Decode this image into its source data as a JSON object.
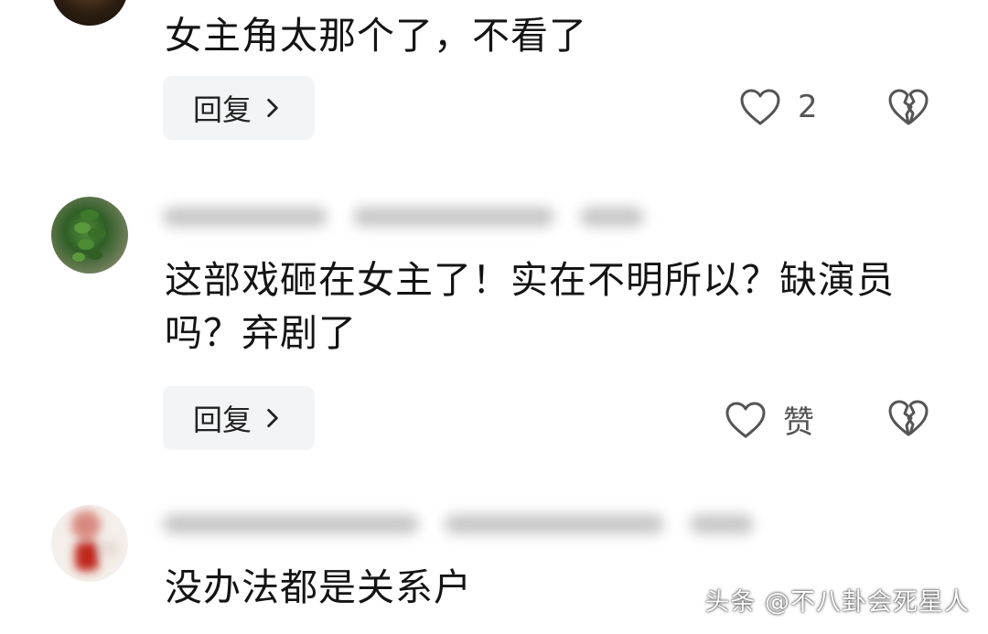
{
  "comments": [
    {
      "text": "女主角太那个了，不看了",
      "reply_label": "回复",
      "like_label": "2"
    },
    {
      "text": "这部戏砸在女主了！实在不明所以？缺演员吗？弃剧了",
      "reply_label": "回复",
      "like_label": "赞"
    },
    {
      "text": "没办法都是关系户"
    }
  ],
  "icons": {
    "like": "heart-outline-icon",
    "dislike": "broken-heart-icon",
    "reply_chevron": "chevron-right-icon"
  },
  "watermark": "头条 @不八卦会死星人",
  "colors": {
    "text": "#141414",
    "button_bg": "#f3f4f5",
    "icon": "#555555"
  }
}
